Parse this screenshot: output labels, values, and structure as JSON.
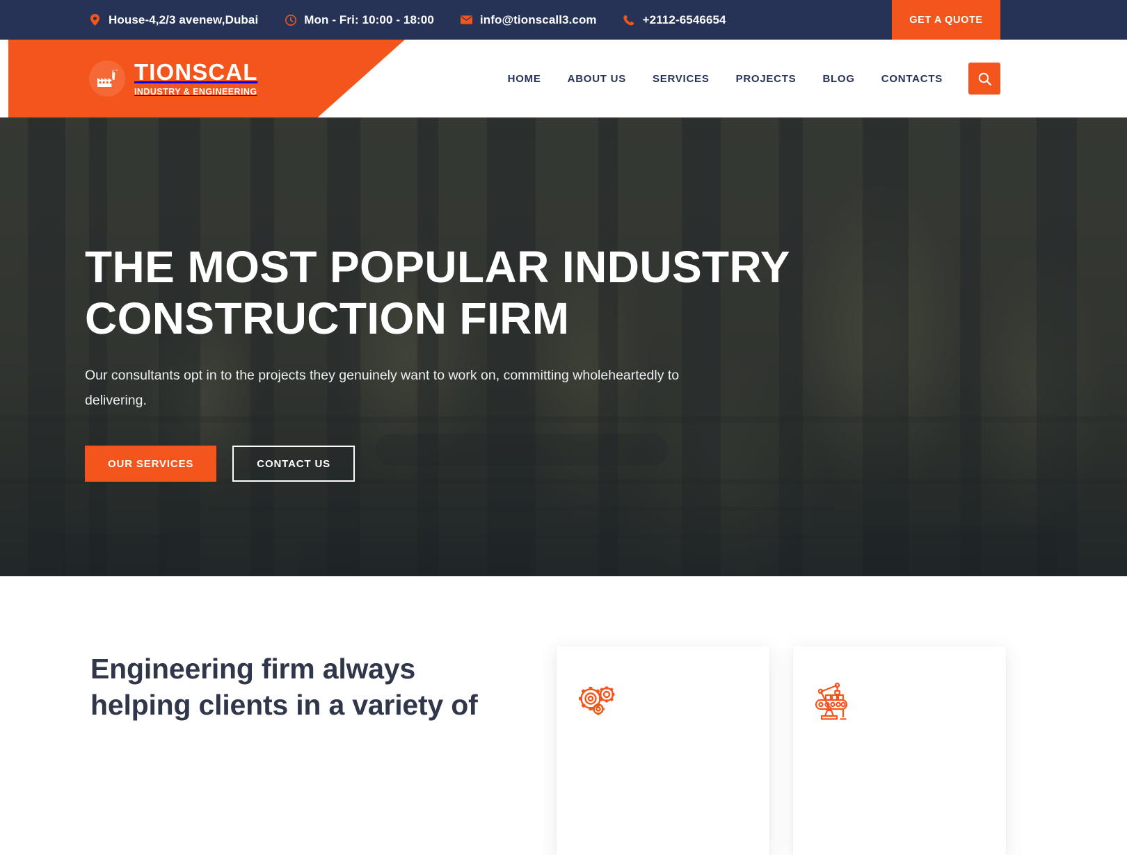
{
  "topbar": {
    "address": "House-4,2/3 avenew,Dubai",
    "hours": "Mon - Fri: 10:00 - 18:00",
    "email": "info@tionscall3.com",
    "phone": "+2112-6546654",
    "quote_button": "GET A QUOTE",
    "icons": {
      "address": "location-pin-icon",
      "hours": "clock-icon",
      "email": "envelope-icon",
      "phone": "phone-icon"
    },
    "colors": {
      "background": "#263357",
      "accent": "#f4551c",
      "text": "#ffffff"
    }
  },
  "header": {
    "logo": {
      "name": "TIONSCAL",
      "tagline": "INDUSTRY & ENGINEERING",
      "icon": "factory-icon"
    },
    "nav": [
      {
        "label": "HOME"
      },
      {
        "label": "ABOUT US"
      },
      {
        "label": "SERVICES"
      },
      {
        "label": "PROJECTS"
      },
      {
        "label": "BLOG"
      },
      {
        "label": "CONTACTS"
      }
    ],
    "search_icon": "search-icon",
    "colors": {
      "banner": "#f4551c",
      "nav_text": "#263357"
    }
  },
  "hero": {
    "title_line1": "THE MOST POPULAR INDUSTRY",
    "title_line2": "CONSTRUCTION FIRM",
    "subtitle_line1": "Our consultants opt in to the projects they genuinely want to work on, committing",
    "subtitle_line2": "wholeheartedly to delivering.",
    "primary_button": "OUR SERVICES",
    "secondary_button": "CONTACT US",
    "background_description": "industrial oil refinery plant at dusk"
  },
  "features": {
    "heading_line1": "Engineering firm always",
    "heading_line2": "helping clients in a variety of",
    "cards": [
      {
        "icon": "gears-icon"
      },
      {
        "icon": "robotic-arm-conveyor-icon"
      }
    ],
    "colors": {
      "heading_text": "#30374a",
      "icon": "#f4551c"
    }
  }
}
